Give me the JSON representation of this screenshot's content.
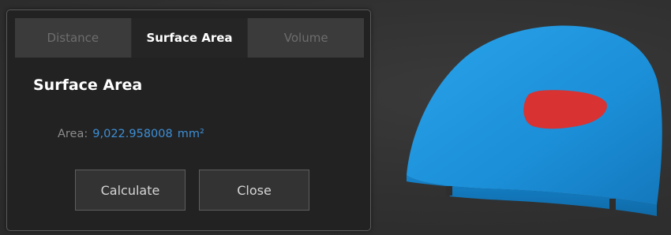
{
  "tabs": [
    {
      "label": "Distance",
      "active": false
    },
    {
      "label": "Surface Area",
      "active": true
    },
    {
      "label": "Volume",
      "active": false
    }
  ],
  "section": {
    "title": "Surface Area"
  },
  "measurement": {
    "label": "Area:",
    "value": "9,022.958008",
    "unit": "mm²"
  },
  "buttons": {
    "calculate_label": "Calculate",
    "close_label": "Close"
  },
  "colors": {
    "model": "#1f8fd6",
    "selection": "#d83232",
    "value_text": "#3d8fd6",
    "background": "#2e2e2e"
  }
}
